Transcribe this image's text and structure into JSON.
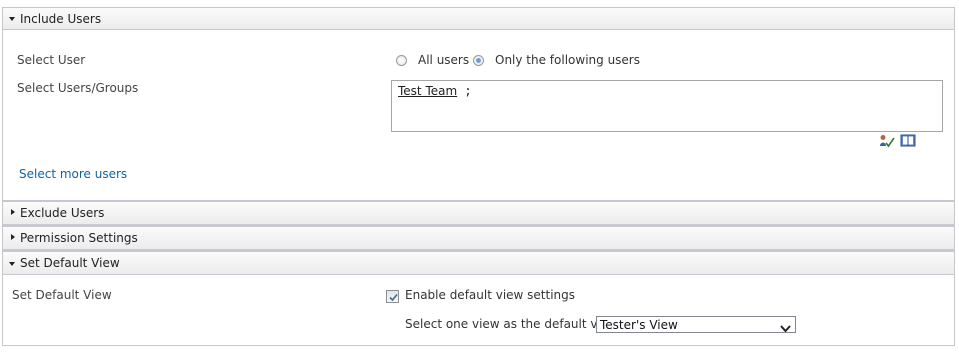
{
  "sections": {
    "include_users": {
      "title": "Include Users",
      "expanded": true
    },
    "exclude_users": {
      "title": "Exclude Users",
      "expanded": false
    },
    "permission_settings": {
      "title": "Permission Settings",
      "expanded": false
    },
    "set_default_view": {
      "title": "Set Default View",
      "expanded": true
    }
  },
  "include_users": {
    "select_user_label": "Select User",
    "options": {
      "all": "All users",
      "following": "Only the following users"
    },
    "selected_option": "following",
    "select_users_groups_label": "Select Users/Groups",
    "people_picker": {
      "name": "Test Team",
      "separator": ";"
    },
    "select_more_link": "Select more users",
    "icons": {
      "check_names": "check-names-icon",
      "browse": "address-book-icon"
    }
  },
  "default_view": {
    "label": "Set Default View",
    "enable_label": "Enable default view settings",
    "enable_checked": true,
    "select_label": "Select one view as the default view:",
    "selected_view": "Tester's View"
  },
  "colors": {
    "link": "#0f62a8",
    "radio_dot": "#6f9fd0",
    "header_border": "#c7c7d2"
  }
}
